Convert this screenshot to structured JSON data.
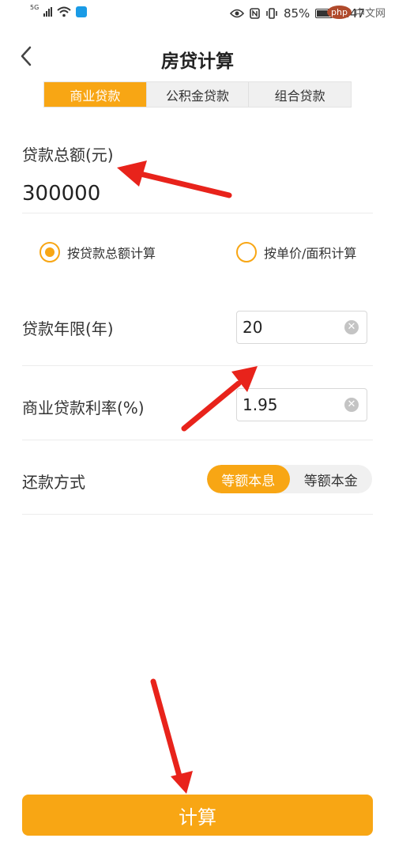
{
  "status_bar": {
    "signal_label": "5G",
    "battery_percent": "85%",
    "time": "9:47"
  },
  "watermark": {
    "badge": "php",
    "text": "中文网"
  },
  "header": {
    "title": "房贷计算",
    "back_icon": "chevron-left-icon"
  },
  "tabs": [
    {
      "label": "商业贷款",
      "active": true
    },
    {
      "label": "公积金贷款",
      "active": false
    },
    {
      "label": "组合贷款",
      "active": false
    }
  ],
  "loan_amount": {
    "label": "贷款总额(元)",
    "value": "300000"
  },
  "calc_mode": {
    "options": [
      {
        "label": "按贷款总额计算",
        "checked": true
      },
      {
        "label": "按单价/面积计算",
        "checked": false
      }
    ]
  },
  "loan_term": {
    "label": "贷款年限(年)",
    "value": "20",
    "clear_icon": "clear-icon"
  },
  "interest_rate": {
    "label": "商业贷款利率(%)",
    "value": "1.95",
    "clear_icon": "clear-icon"
  },
  "repayment": {
    "label": "还款方式",
    "options": [
      {
        "label": "等额本息",
        "active": true
      },
      {
        "label": "等额本金",
        "active": false
      }
    ]
  },
  "calculate_button": {
    "label": "计算"
  },
  "colors": {
    "accent": "#f8a614",
    "annotation_arrow": "#e8231b"
  }
}
